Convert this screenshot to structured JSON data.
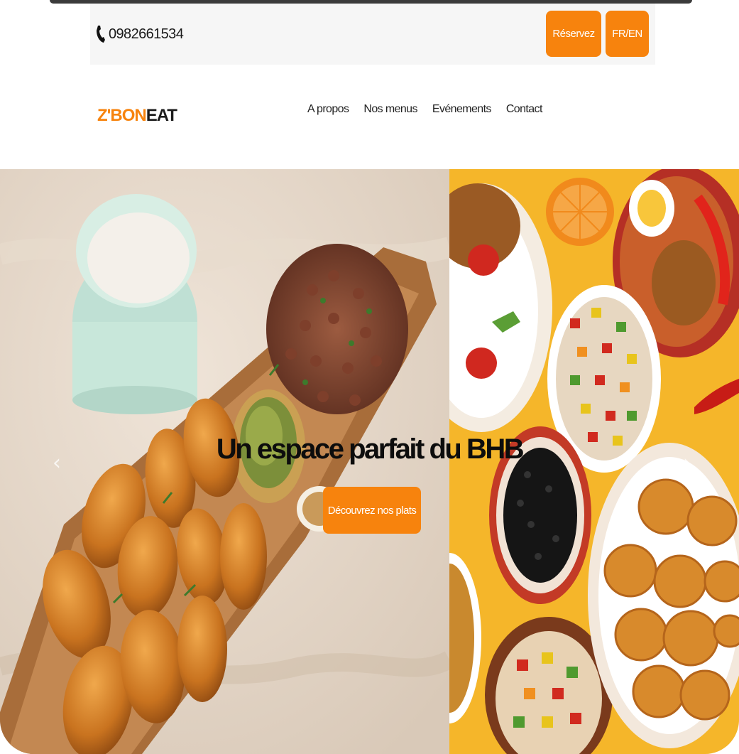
{
  "topbar": {
    "phone_icon": "phone-icon",
    "phone": "0982661534",
    "reserve_label": "Réservez",
    "language_label": "FR/EN"
  },
  "brand": {
    "logo_part1": "Z'BON",
    "logo_part2": "EAT",
    "accent_color": "#f7830d"
  },
  "nav": {
    "items": [
      {
        "label": "A propos"
      },
      {
        "label": "Nos menus"
      },
      {
        "label": "Evénements"
      },
      {
        "label": "Contact"
      }
    ]
  },
  "hero": {
    "title": "Un espace parfait du BHB",
    "cta_label": "Découvrez nos plats",
    "prev_icon": "chevron-left-icon",
    "next_icon": "chevron-right-icon",
    "prev_glyph": "‹",
    "next_glyph": "›"
  }
}
